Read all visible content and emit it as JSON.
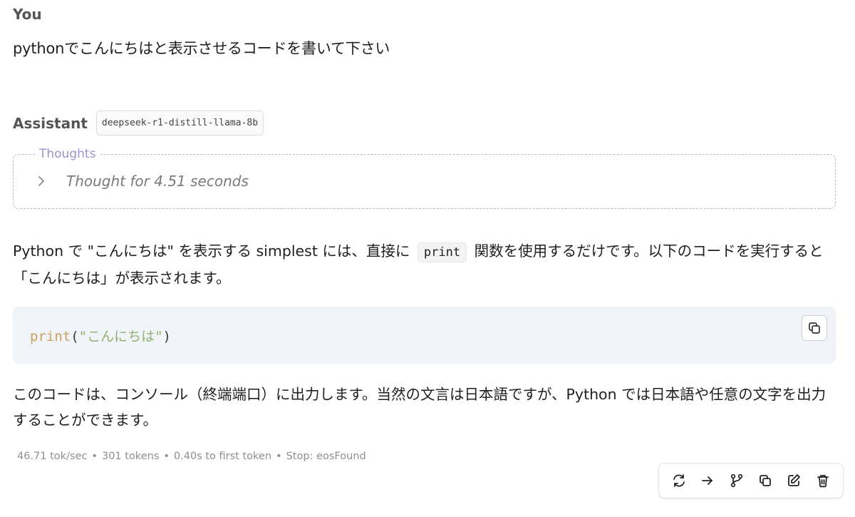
{
  "user": {
    "label": "You",
    "message": "pythonでこんにちはと表示させるコードを書いて下さい"
  },
  "assistant": {
    "label": "Assistant",
    "model": "deepseek-r1-distill-llama-8b",
    "thoughts": {
      "legend": "Thoughts",
      "summary": "Thought for 4.51 seconds"
    },
    "paragraph1": {
      "before": "Python で \"こんにちは\" を表示する simplest には、直接に",
      "code": "print",
      "after": "関数を使用するだけです。以下のコードを実行すると「こんにちは」が表示されます。"
    },
    "code_block": {
      "fn": "print",
      "open": "(",
      "string": "\"こんにちは\"",
      "close": ")"
    },
    "paragraph2": "このコードは、コンソール（終端端口）に出力します。当然の文言は日本語ですが、Python では日本語や任意の文字を出力することができます。",
    "stats": {
      "speed": "46.71 tok/sec",
      "tokens": "301 tokens",
      "first_token": "0.40s to first token",
      "stop": "Stop: eosFound",
      "separator": "•"
    }
  },
  "actions": [
    {
      "icon": "regenerate-icon"
    },
    {
      "icon": "continue-arrow-icon"
    },
    {
      "icon": "branch-icon"
    },
    {
      "icon": "copy-icon"
    },
    {
      "icon": "edit-icon"
    },
    {
      "icon": "trash-icon"
    }
  ],
  "colors": {
    "thoughts_accent": "#9d92cf",
    "code_bg": "#f0f3f7",
    "code_fn": "#c9a15f",
    "code_string": "#8fb36d"
  }
}
